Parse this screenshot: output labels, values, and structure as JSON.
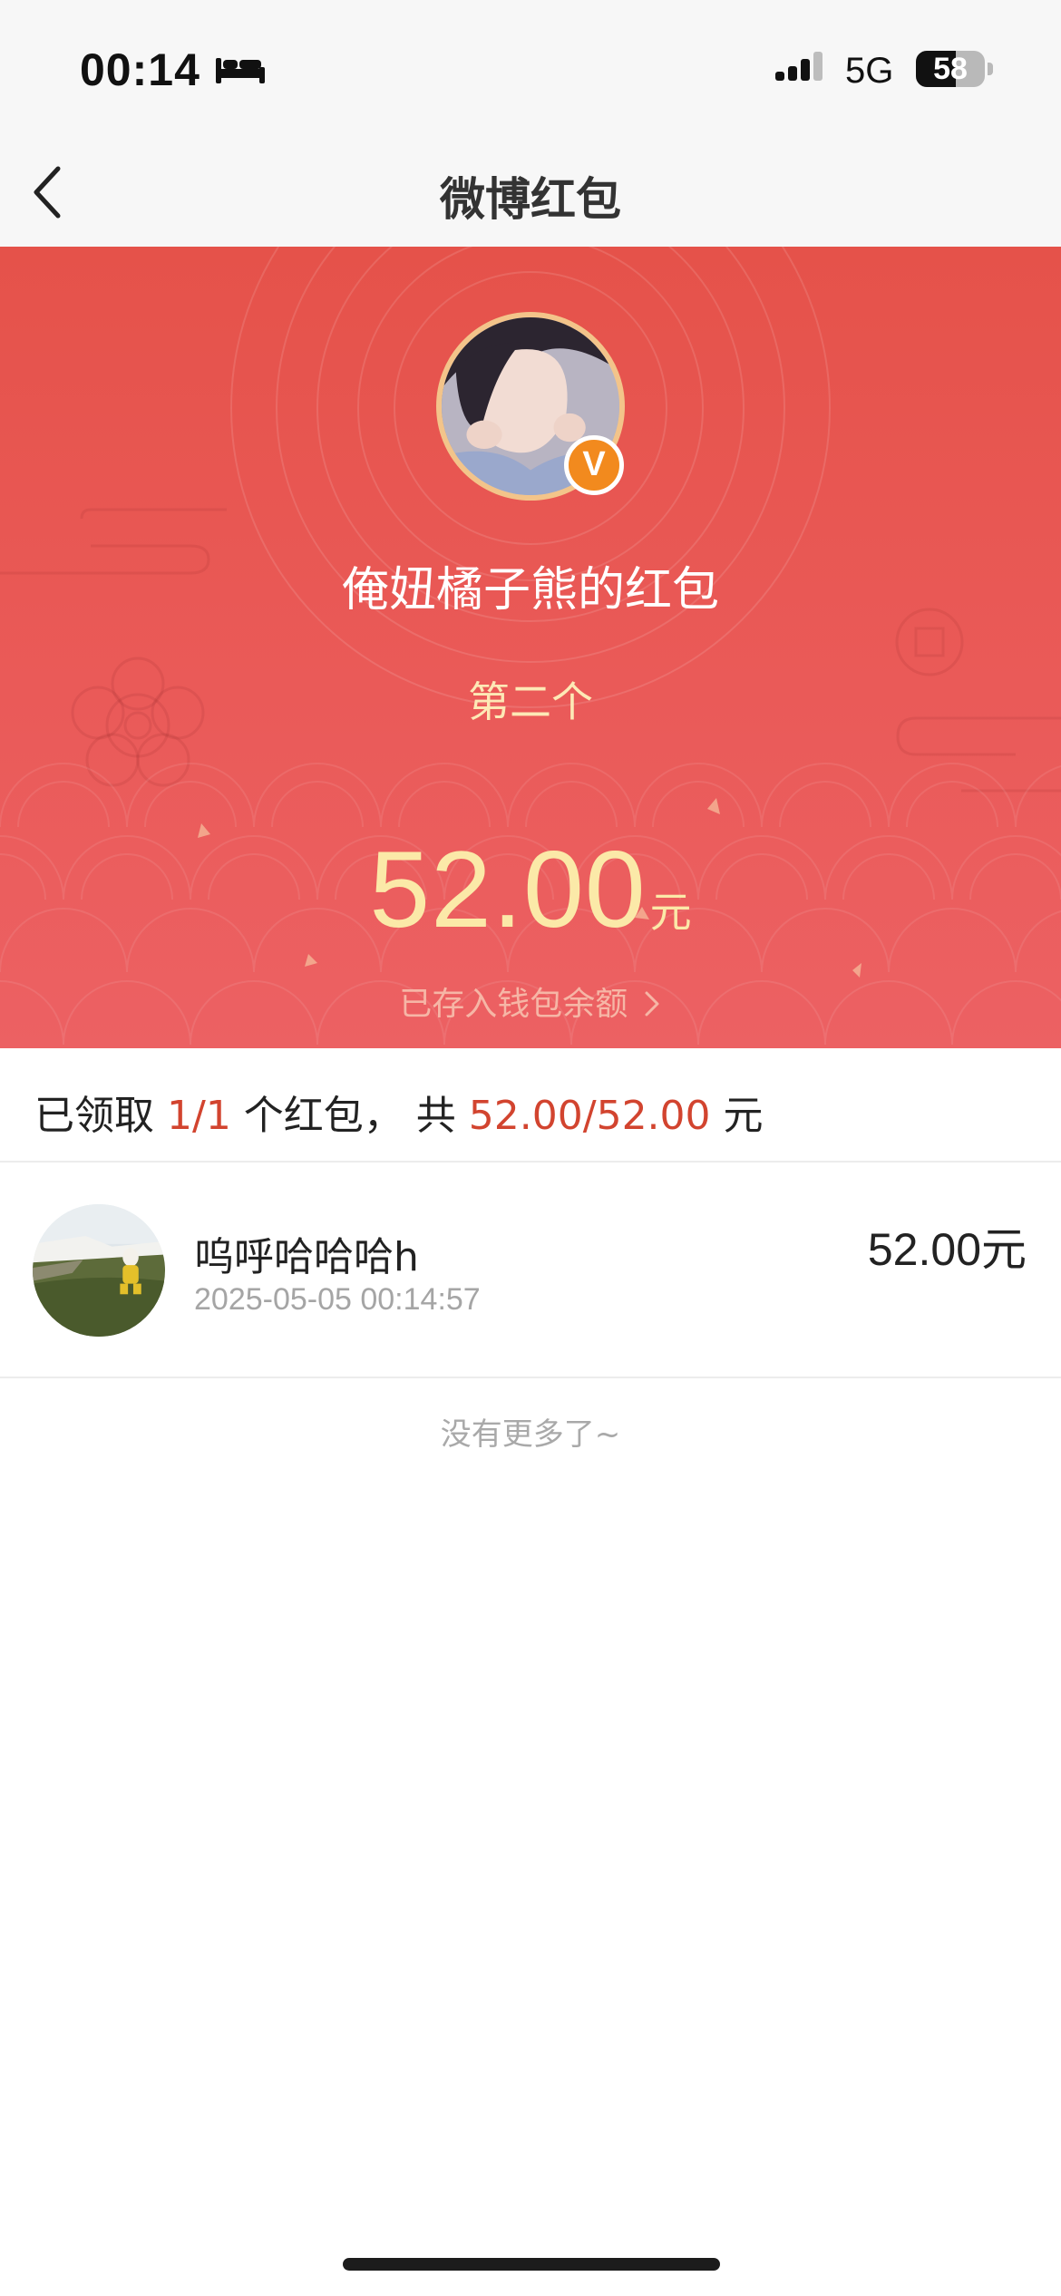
{
  "status_bar": {
    "time": "00:14",
    "network": "5G",
    "battery_percent": 58,
    "battery_label": "58",
    "icons": [
      "bed-icon",
      "signal-icon",
      "battery-icon"
    ]
  },
  "nav": {
    "title": "微博红包",
    "back_icon": "chevron-left-icon"
  },
  "header": {
    "sender_title": "俺妞橘子熊的红包",
    "subtitle": "第二个",
    "amount": "52.00",
    "amount_unit": "元",
    "wallet_link": "已存入钱包余额",
    "wallet_link_icon": "chevron-right-icon",
    "verified_badge": "V",
    "colors": {
      "header_top": "#e5524a",
      "header_bottom": "#ec6163",
      "amount": "#fbe9a8",
      "badge": "#f28a1e",
      "avatar_ring": "#f3c48a"
    }
  },
  "summary": {
    "prefix": "已领取 ",
    "received": "1/1",
    "middle": " 个红包， 共 ",
    "total": "52.00/52.00",
    "suffix": " 元",
    "highlight_color": "#d2442f"
  },
  "recipients": [
    {
      "name": "呜呼哈哈哈h",
      "time": "2025-05-05 00:14:57",
      "amount": "52.00",
      "unit": "元"
    }
  ],
  "footer": {
    "no_more": "没有更多了~"
  }
}
